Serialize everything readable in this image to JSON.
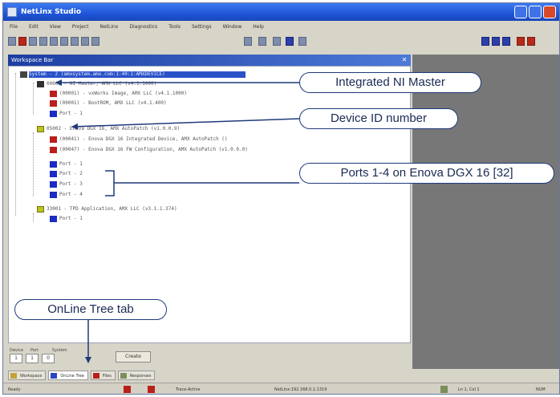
{
  "window": {
    "title": "NetLinx Studio",
    "menu": [
      "File",
      "Edit",
      "View",
      "Project",
      "NetLinx",
      "Diagnostics",
      "Tools",
      "Settings",
      "Window",
      "Help"
    ]
  },
  "workspace": {
    "panel_title": "Workspace Bar"
  },
  "tree": [
    {
      "text": "System - 2 (amxsystem.amx.com:1:40:1:AMXDEVICE)",
      "icon": "system",
      "selected": true
    },
    {
      "text": "00000 - NI Master, AMX LLC (v4.1.1000)",
      "icon": "master"
    },
    {
      "text": "(00001) - vxWorks Image, AMX LLC (v4.1.1000)",
      "icon": "red"
    },
    {
      "text": "(00001) - BootROM, AMX LLC (v4.1.400)",
      "icon": "red"
    },
    {
      "text": "Port - 1",
      "icon": "port"
    },
    {
      "text": "05002 - Enova DGX 16, AMX AutoPatch (v1.0.0.9)",
      "icon": "device"
    },
    {
      "text": "(00041) - Enova DGX 16 Integrated Device, AMX AutoPatch ()",
      "icon": "red"
    },
    {
      "text": "(00047) - Enova DGX 16 FW Configuration, AMX AutoPatch (v1.0.0.0)",
      "icon": "red"
    },
    {
      "text": "Port - 1",
      "icon": "port"
    },
    {
      "text": "Port - 2",
      "icon": "port"
    },
    {
      "text": "Port - 3",
      "icon": "port"
    },
    {
      "text": "Port - 4",
      "icon": "port"
    },
    {
      "text": "33001 - TPD Application, AMX LLC (v3.1.1.374)",
      "icon": "device"
    },
    {
      "text": "Port - 1",
      "icon": "port"
    }
  ],
  "fields": {
    "device_label": "Device",
    "port_label": "Port",
    "system_label": "System",
    "device_value": "1",
    "port_value": "1",
    "system_value": "0",
    "create_button": "Create"
  },
  "tabs": [
    {
      "label": "Workspace",
      "active": false
    },
    {
      "label": "OnLine Tree",
      "active": true
    },
    {
      "label": "Files",
      "active": false
    },
    {
      "label": "Responses",
      "active": false
    }
  ],
  "status": {
    "ready": "Ready",
    "connection": "Trace-Active",
    "address": "NetLinx:192.168.0.1:1319",
    "position": "Ln 1, Col 1",
    "mode": "NUM"
  },
  "callouts": {
    "master": "Integrated NI Master",
    "device_id": "Device ID number",
    "ports": "Ports 1-4 on Enova DGX 16 [32]",
    "tab": "OnLine Tree tab"
  }
}
